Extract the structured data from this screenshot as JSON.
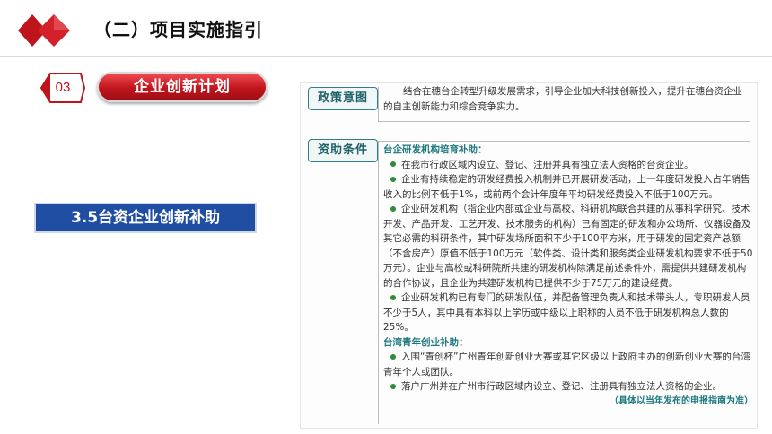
{
  "header": {
    "title": "（二）项目实施指引"
  },
  "section": {
    "number": "03",
    "label": "企业创新计划"
  },
  "sub_heading": "3.5台资企业创新补助",
  "document": {
    "policy_label": "政策意图",
    "policy_text": "结合在穗台企转型升级发展需求，引导企业加大科技创新投入，提升在穗台资企业的自主创新能力和综合竞争实力。",
    "conditions_label": "资助条件",
    "section1_title": "台企研发机构培育补助：",
    "section1_items": [
      "在我市行政区域内设立、登记、注册并具有独立法人资格的台资企业。",
      "企业有持续稳定的研发经费投入机制并已开展研发活动，上一年度研发投入占年销售收入的比例不低于1%，或前两个会计年度年平均研发经费投入不低于100万元。",
      "企业研发机构（指企业内部或企业与高校、科研机构联合共建的从事科学研究、技术开发、产品开发、工艺开发、技术服务的机构）已有固定的研发和办公场所、仪器设备及其它必需的科研条件，其中研发场所面积不少于100平方米，用于研发的固定资产总额（不含房产）原值不低于100万元（软件类、设计类和服务类企业研发机构要求不低于50万元）。企业与高校或科研院所共建的研发机构除满足前述条件外，需提供共建研发机构的合作协议，且企业为共建研发机构已提供不少于75万元的建设经费。",
      "企业研发机构已有专门的研发队伍，并配备管理负责人和技术带头人，专职研发人员不少于5人，其中具有本科以上学历或中级以上职称的人员不低于研发机构总人数的25%。"
    ],
    "section2_title": "台湾青年创业补助：",
    "section2_items": [
      "入围“青创杯”广州青年创新创业大赛或其它区级以上政府主办的创新创业大赛的台湾青年个人或团队。",
      "落户广州并在广州市行政区域内设立、登记、注册具有独立法人资格的企业。"
    ],
    "note": "（具体以当年发布的申报指南为准）"
  },
  "colors": {
    "brand_red": "#c0141c",
    "brand_blue": "#1f4ea3",
    "doc_teal": "#1e7a80"
  }
}
